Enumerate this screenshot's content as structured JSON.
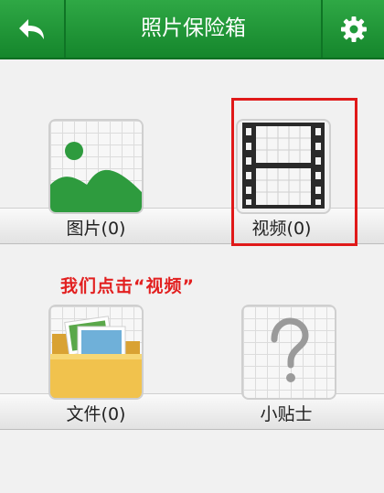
{
  "header": {
    "title": "照片保险箱",
    "back_icon": "back-arrow-icon",
    "settings_icon": "gear-icon",
    "color": "#1f9a3a"
  },
  "grid": {
    "items": [
      {
        "label": "图片(0)",
        "icon": "landscape-photo-icon"
      },
      {
        "label": "视频(0)",
        "icon": "film-strip-icon",
        "highlighted": true
      },
      {
        "label": "文件(0)",
        "icon": "folder-icon"
      },
      {
        "label": "小贴士",
        "icon": "question-mark-icon"
      }
    ]
  },
  "annotation": {
    "text": "我们点击“视频”",
    "color": "#e21f1f"
  }
}
